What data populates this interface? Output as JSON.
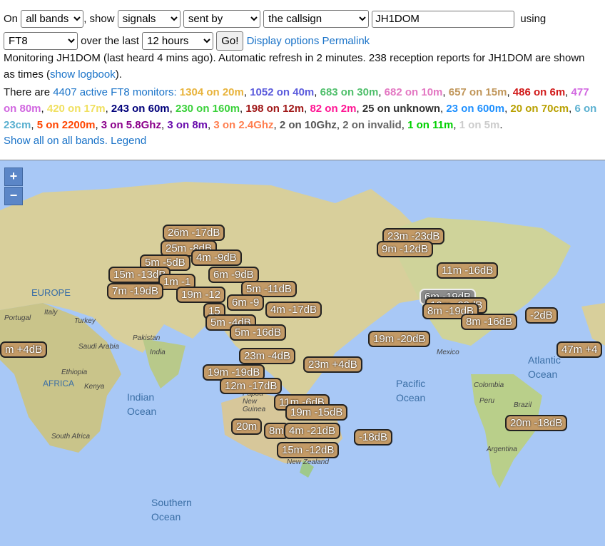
{
  "controls": {
    "on_label": "On",
    "band_select": "all bands",
    "show_label": ", show",
    "type_select": "signals",
    "direction_select": "sent by",
    "target_select": "the callsign",
    "callsign_value": "JH1DOM",
    "using_label": "using",
    "mode_select": "FT8",
    "over_label": "over the last",
    "period_select": "12 hours",
    "go_label": "Go!",
    "display_options": "Display options",
    "permalink": "Permalink"
  },
  "status": {
    "line1": "Monitoring JH1DOM (last heard 4 mins ago). Automatic refresh in 2 minutes. 238 reception reports for JH1DOM are shown",
    "line2_prefix": "as times (",
    "logbook_link": "show logbook",
    "line2_suffix": ").",
    "there_are": "There are ",
    "monitors_link": "4407 active FT8 monitors:",
    "show_all": "Show all on all bands.",
    "legend": "Legend"
  },
  "bands": [
    {
      "text": "1304 on 20m",
      "color": "#e8b33b"
    },
    {
      "text": "1052 on 40m",
      "color": "#5a5adc"
    },
    {
      "text": "683 on 30m",
      "color": "#4fbf6b"
    },
    {
      "text": "682 on 10m",
      "color": "#e377c2"
    },
    {
      "text": "657 on 15m",
      "color": "#c0965a"
    },
    {
      "text": "486 on 6m",
      "color": "#d11a1a"
    },
    {
      "text": "477 on 80m",
      "color": "#d166e0"
    },
    {
      "text": "420 on 17m",
      "color": "#f0e060"
    },
    {
      "text": "243 on 60m",
      "color": "#00007a"
    },
    {
      "text": "230 on 160m",
      "color": "#3ad13a"
    },
    {
      "text": "198 on 12m",
      "color": "#a01818"
    },
    {
      "text": "82 on 2m",
      "color": "#ff1493"
    },
    {
      "text": "25 on unknown",
      "color": "#333333"
    },
    {
      "text": "23 on 600m",
      "color": "#1e90ff"
    },
    {
      "text": "20 on 70cm",
      "color": "#b8a000"
    },
    {
      "text": "6 on 23cm",
      "color": "#5ab0d0"
    },
    {
      "text": "5 on 2200m",
      "color": "#ff4500"
    },
    {
      "text": "3 on 5.8Ghz",
      "color": "#8b008b"
    },
    {
      "text": "3 on 8m",
      "color": "#6a0dad"
    },
    {
      "text": "3 on 2.4Ghz",
      "color": "#ff7f50"
    },
    {
      "text": "2 on 10Ghz",
      "color": "#555555"
    },
    {
      "text": "2 on invalid",
      "color": "#666666"
    },
    {
      "text": "1 on 11m",
      "color": "#00d000"
    },
    {
      "text": "1 on 5m",
      "color": "#cccccc"
    }
  ],
  "map": {
    "zoom_in": "+",
    "zoom_out": "−",
    "labels": [
      "EUROPE",
      "Indian Ocean",
      "Pacific Ocean",
      "Atlantic Ocean",
      "Southern Ocean",
      "AFRICA"
    ],
    "small_labels": [
      "Portugal",
      "Italy",
      "Turkey",
      "Saudi Arabia",
      "Pakistan",
      "India",
      "Ethiopia",
      "Kenya",
      "South Africa",
      "Mexico",
      "Colombia",
      "Peru",
      "Brazil",
      "Argentina",
      "New Zealand",
      "Papua New Guinea"
    ],
    "reports": [
      "26m -17dB",
      "25m -8dB",
      "5m -5dB",
      "4m -9dB",
      "15m -13dB",
      "1m -1",
      "6m -9dB",
      "7m -19dB",
      "19m -12",
      "5m -11dB",
      "6m -9",
      "4m -17dB",
      "15",
      "5m -4dB",
      "5m -16dB",
      "23m -4dB",
      "23m +4dB",
      "19m -19dB",
      "12m -17dB",
      "11m -6dB",
      "19m -15dB",
      "20m",
      "8m",
      "4m -21dB",
      "-18dB",
      "15m -12dB",
      "m +4dB",
      "23m -23dB",
      "9m -12dB",
      "11m -16dB",
      "6m -19dB",
      "10m -22dB",
      "8m -19dB",
      "-2dB",
      "8m -16dB",
      "19m -20dB",
      "47m +4",
      "20m -18dB"
    ]
  }
}
